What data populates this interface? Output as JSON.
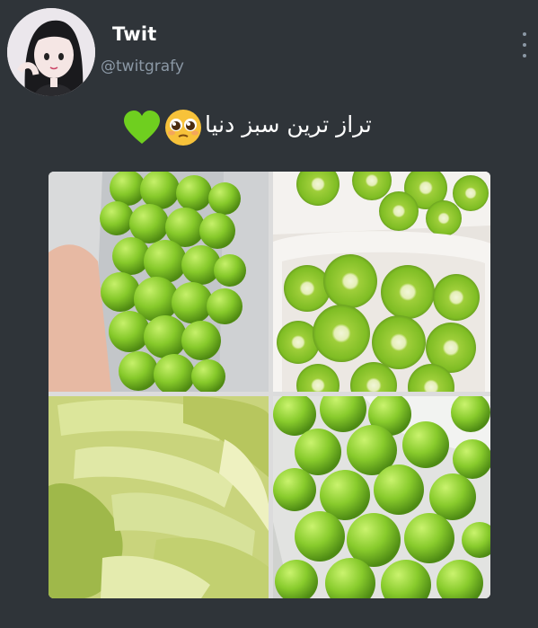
{
  "user": {
    "display_name": "Twit",
    "handle": "@twitgrafy"
  },
  "tweet": {
    "text": "تراز ترین سبز دنیا",
    "emojis": [
      "green-heart-icon",
      "pleading-face-icon"
    ]
  },
  "images": [
    {
      "subject": "green-plums-in-hand"
    },
    {
      "subject": "sliced-kiwi-in-bowls"
    },
    {
      "subject": "green-mango-slices"
    },
    {
      "subject": "green-plums-in-bag"
    }
  ],
  "colors": {
    "background": "#2f3439",
    "name_text": "#ffffff",
    "handle_text": "#8b98a5",
    "fruit_green": "#7ec21e"
  }
}
